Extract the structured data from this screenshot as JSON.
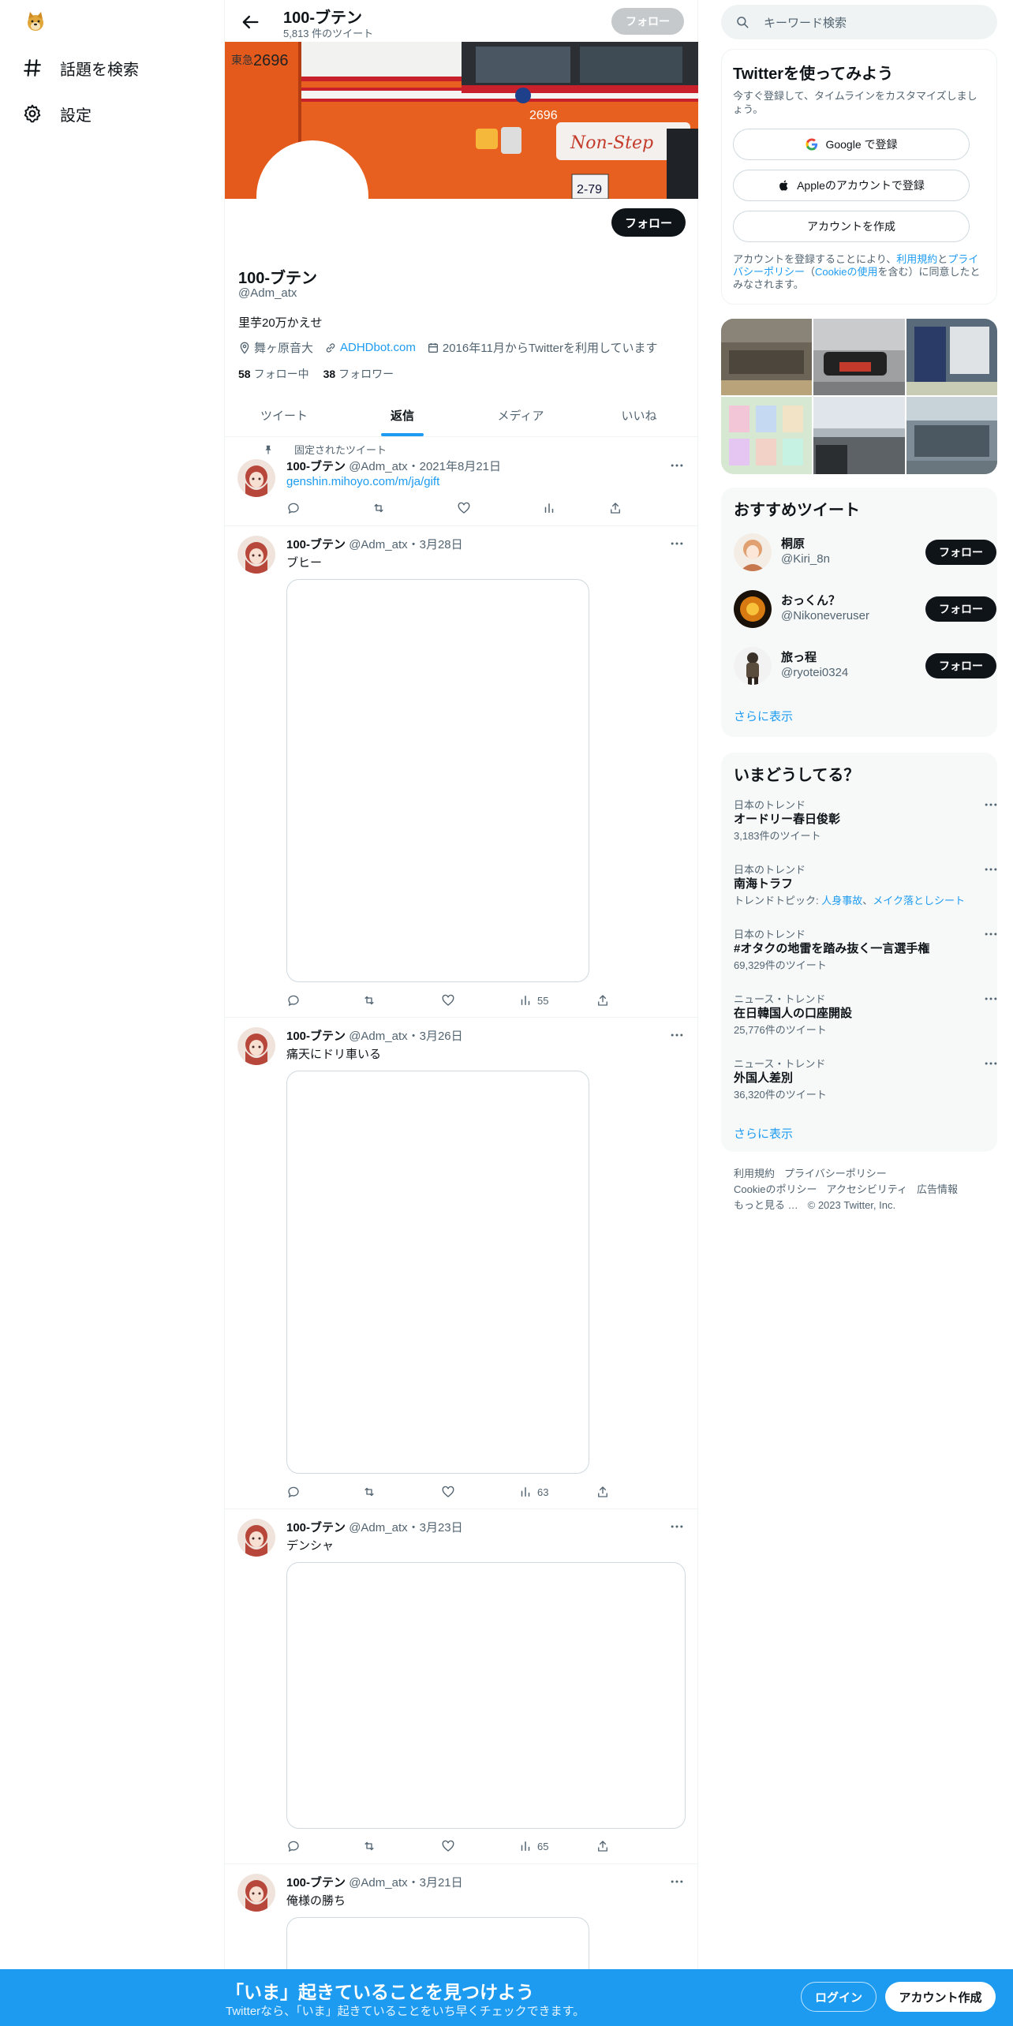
{
  "nav": {
    "explore_label": "話題を検索",
    "settings_label": "設定"
  },
  "header": {
    "name": "100-ブテン",
    "tweet_count": "5,813 件のツイート",
    "follow_label": "フォロー"
  },
  "profile": {
    "follow_label": "フォロー",
    "name": "100-ブテン",
    "handle": "@Adm_atx",
    "bio": "里芋20万かえせ",
    "location": "舞ヶ原音大",
    "website": "ADHDbot.com",
    "joined": "2016年11月からTwitterを利用しています",
    "following_count": "58",
    "following_label": "フォロー中",
    "followers_count": "38",
    "followers_label": "フォロワー"
  },
  "tabs": [
    {
      "label": "ツイート"
    },
    {
      "label": "返信"
    },
    {
      "label": "メディア"
    },
    {
      "label": "いいね"
    }
  ],
  "tweets": [
    {
      "pinned_label": "固定されたツイート",
      "name": "100-ブテン",
      "handle_date": "@Adm_atx・2021年8月21日",
      "link": "genshin.mihoyo.com/m/ja/gift",
      "views": ""
    },
    {
      "name": "100-ブテン",
      "handle_date": "@Adm_atx・3月28日",
      "text": "ブヒー",
      "views": "55"
    },
    {
      "name": "100-ブテン",
      "handle_date": "@Adm_atx・3月26日",
      "text": "痛天にドリ車いる",
      "views": "63"
    },
    {
      "name": "100-ブテン",
      "handle_date": "@Adm_atx・3月23日",
      "text": "デンシャ",
      "views": "65"
    },
    {
      "name": "100-ブテン",
      "handle_date": "@Adm_atx・3月21日",
      "text": "俺様の勝ち"
    }
  ],
  "search": {
    "placeholder": "キーワード検索"
  },
  "signup": {
    "title": "Twitterを使ってみよう",
    "subtitle": "今すぐ登録して、タイムラインをカスタマイズしましょう。",
    "google_label": "Google で登録",
    "apple_label": "Appleのアカウントで登録",
    "create_label": "アカウントを作成",
    "legal_1": "アカウントを登録することにより、",
    "legal_terms": "利用規約",
    "legal_2": "と",
    "legal_privacy": "プライバシーポリシー",
    "legal_3": "（",
    "legal_cookie": "Cookieの使用",
    "legal_4": "を含む）に同意したとみなされます。"
  },
  "recommended": {
    "title": "おすすめツイート",
    "users": [
      {
        "name": "桐原",
        "handle": "@Kiri_8n",
        "button": "フォロー"
      },
      {
        "name": "おっくん？",
        "handle": "@Nikoneveruser",
        "button": "フォロー"
      },
      {
        "name": "旅っ程",
        "handle": "@ryotei0324",
        "button": "フォロー"
      }
    ],
    "more": "さらに表示"
  },
  "trends": {
    "title": "いまどうしてる？",
    "items": [
      {
        "category": "日本のトレンド",
        "name": "オードリー春日俊彰",
        "count": "3,183件のツイート"
      },
      {
        "category": "日本のトレンド",
        "name": "南海トラフ",
        "topic_prefix": "トレンドトピック: ",
        "topic_1": "人身事故",
        "topic_sep": "、",
        "topic_2": "メイク落としシート"
      },
      {
        "category": "日本のトレンド",
        "name": "#オタクの地雷を踏み抜く一言選手権",
        "count": "69,329件のツイート"
      },
      {
        "category": "ニュース・トレンド",
        "name": "在日韓国人の口座開設",
        "count": "25,776件のツイート"
      },
      {
        "category": "ニュース・トレンド",
        "name": "外国人差別",
        "count": "36,320件のツイート"
      }
    ],
    "more": "さらに表示"
  },
  "footer": {
    "terms": "利用規約",
    "privacy": "プライバシーポリシー",
    "cookie": "Cookieのポリシー",
    "accessibility": "アクセシビリティ",
    "ads": "広告情報",
    "more": "もっと見る …",
    "copyright": "© 2023 Twitter, Inc."
  },
  "bottom_bar": {
    "title": "「いま」起きていることを見つけよう",
    "subtitle": "Twitterなら、「いま」起きていることをいち早くチェックできます。",
    "login_label": "ログイン",
    "signup_label": "アカウント作成"
  },
  "colors": {
    "accent": "#1d9bf0",
    "text": "#0f1419",
    "muted": "#536471",
    "banner_orange": "#e85a1e"
  }
}
